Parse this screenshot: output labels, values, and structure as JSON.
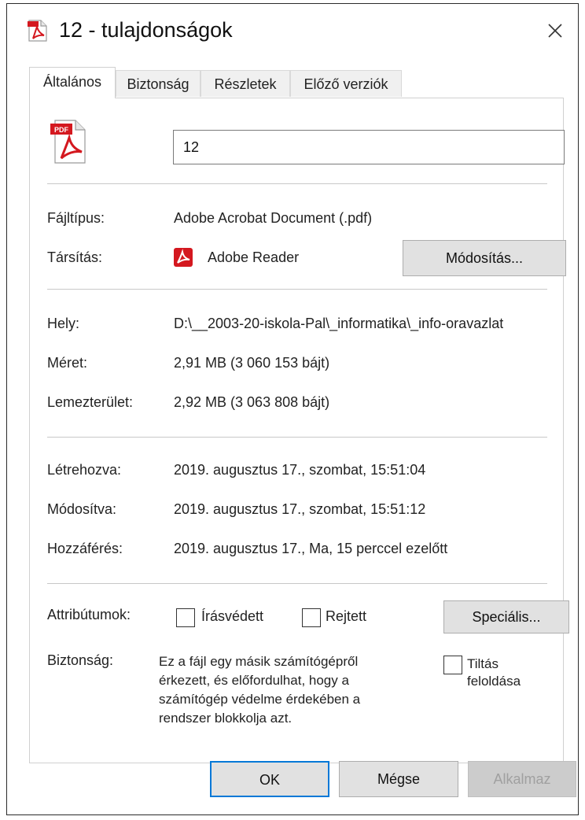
{
  "window": {
    "title": "12 - tulajdonságok"
  },
  "icons": {
    "title": "pdf-file-icon",
    "close": "close-icon",
    "document": "pdf-document-icon",
    "reader": "adobe-reader-icon",
    "pdf_badge": "PDF",
    "accent": "#d4181f"
  },
  "tabs": [
    {
      "label": "Általános",
      "active": true
    },
    {
      "label": "Biztonság",
      "active": false
    },
    {
      "label": "Részletek",
      "active": false
    },
    {
      "label": "Előző verziók",
      "active": false
    }
  ],
  "general": {
    "filename": "12",
    "filetype_label": "Fájltípus:",
    "filetype_value": "Adobe Acrobat Document (.pdf)",
    "assoc_label": "Társítás:",
    "assoc_value": "Adobe Reader",
    "change_button": "Módosítás...",
    "location_label": "Hely:",
    "location_value": "D:\\__2003-20-iskola-Pal\\_informatika\\_info-oravazlat",
    "size_label": "Méret:",
    "size_value": "2,91 MB (3 060 153 bájt)",
    "disk_label": "Lemezterület:",
    "disk_value": "2,92 MB (3 063 808 bájt)",
    "created_label": "Létrehozva:",
    "created_value": "2019. augusztus 17., szombat, 15:51:04",
    "modified_label": "Módosítva:",
    "modified_value": "2019. augusztus 17., szombat, 15:51:12",
    "accessed_label": "Hozzáférés:",
    "accessed_value": "2019. augusztus 17., Ma, 15 perccel ezelőtt",
    "attributes_label": "Attribútumok:",
    "readonly_label": "Írásvédett",
    "readonly_checked": false,
    "hidden_label": "Rejtett",
    "hidden_checked": false,
    "advanced_button": "Speciális...",
    "security_label": "Biztonság:",
    "security_text": [
      "Ez a fájl egy másik számítógépről",
      "érkezett, és előfordulhat, hogy a",
      "számítógép védelme érdekében a",
      "rendszer blokkolja azt."
    ],
    "unblock_label": [
      "Tiltás",
      "feloldása"
    ],
    "unblock_checked": false
  },
  "buttons": {
    "ok": "OK",
    "cancel": "Mégse",
    "apply": "Alkalmaz"
  },
  "colors": {
    "disabled_text": "#a0a0a0",
    "default_border": "#0078d7"
  }
}
